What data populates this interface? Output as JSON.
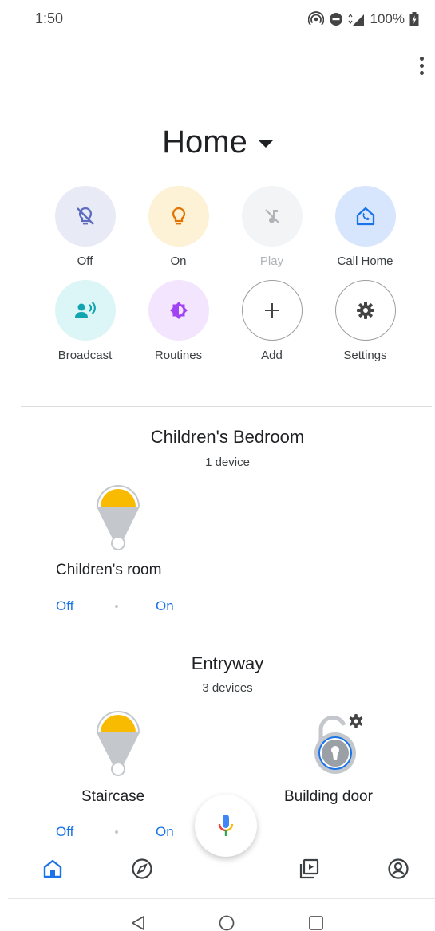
{
  "status_bar": {
    "time": "1:50",
    "battery": "100%"
  },
  "home": {
    "title": "Home"
  },
  "actions": [
    {
      "label": "Off",
      "icon": "light-off-icon",
      "bg": "#e8eaf6",
      "color": "#5c6bc0"
    },
    {
      "label": "On",
      "icon": "lightbulb-icon",
      "bg": "#fdf1d6",
      "color": "#e37400"
    },
    {
      "label": "Play",
      "icon": "music-off-icon",
      "bg": "#f3f4f6",
      "color": "#b0b3b8"
    },
    {
      "label": "Call Home",
      "icon": "call-home-icon",
      "bg": "#d7e6fd",
      "color": "#1a73e8"
    },
    {
      "label": "Broadcast",
      "icon": "broadcast-icon",
      "bg": "#dcf5f7",
      "color": "#12a4af"
    },
    {
      "label": "Routines",
      "icon": "routines-icon",
      "bg": "#f3e5fd",
      "color": "#a142f4"
    },
    {
      "label": "Add",
      "icon": "plus-icon",
      "bg": "#ffffff",
      "color": "#444444"
    },
    {
      "label": "Settings",
      "icon": "gear-icon",
      "bg": "#ffffff",
      "color": "#444444"
    }
  ],
  "rooms": [
    {
      "name": "Children's Bedroom",
      "count": "1 device",
      "devices": [
        {
          "name": "Children's room",
          "off_label": "Off",
          "on_label": "On"
        }
      ]
    },
    {
      "name": "Entryway",
      "count": "3 devices",
      "devices": [
        {
          "name": "Staircase",
          "off_label": "Off",
          "on_label": "On"
        },
        {
          "name": "Building door"
        }
      ]
    }
  ],
  "colors": {
    "accent": "#1a73e8",
    "bulb_yellow": "#f9bb02",
    "bulb_grey": "#c4c7cb"
  }
}
